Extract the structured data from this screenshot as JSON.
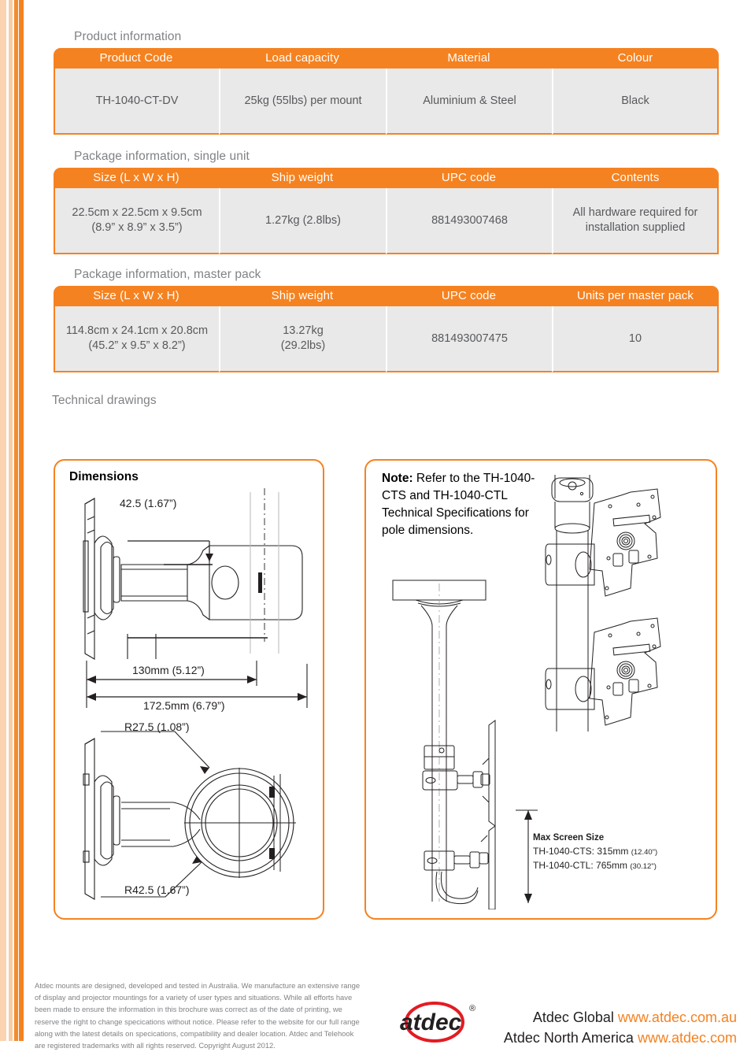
{
  "theme": {
    "accent": "#f58220",
    "header_text": "#ffffff",
    "cell_bg": "#e9e9ea",
    "label_gray": "#808285",
    "body_text": "#58595b"
  },
  "sections": {
    "product_information_label": "Product information",
    "package_single_label": "Package information, single unit",
    "package_master_label": "Package information, master pack",
    "technical_drawings_label": "Technical drawings"
  },
  "product_table": {
    "headers": [
      "Product Code",
      "Load capacity",
      "Material",
      "Colour"
    ],
    "rows": [
      [
        "TH-1040-CT-DV",
        "25kg (55lbs) per mount",
        "Aluminium & Steel",
        "Black"
      ]
    ]
  },
  "package_single_table": {
    "headers": [
      "Size (L x W x H)",
      "Ship weight",
      "UPC code",
      "Contents"
    ],
    "rows": [
      [
        "22.5cm x 22.5cm x 9.5cm\n(8.9” x 8.9” x 3.5”)",
        "1.27kg (2.8lbs)",
        "881493007468",
        "All hardware required for installation supplied"
      ]
    ]
  },
  "package_master_table": {
    "headers": [
      "Size (L x W x H)",
      "Ship weight",
      "UPC code",
      "Units per master pack"
    ],
    "rows": [
      [
        "114.8cm x 24.1cm x 20.8cm\n(45.2” x 9.5” x 8.2”)",
        "13.27kg\n(29.2lbs)",
        "881493007475",
        "10"
      ]
    ]
  },
  "dimensions_panel": {
    "title": "Dimensions",
    "labels": {
      "height_offset": "42.5 (1.67”)",
      "width_inner": "130mm (5.12”)",
      "width_outer": "172.5mm (6.79”)",
      "radius_inner": "R27.5 (1.08”)",
      "radius_outer": "R42.5 (1.67”)"
    }
  },
  "note_panel": {
    "note_prefix": "Note:",
    "note_body": " Refer to the TH-1040-CTS and TH-1040-CTL Technical Specifications for pole dimensions.",
    "max_screen": {
      "title": "Max Screen Size",
      "lines": [
        {
          "model": "TH-1040-CTS: 315mm",
          "inches": "(12.40\")"
        },
        {
          "model": "TH-1040-CTL: 765mm",
          "inches": "(30.12\")"
        }
      ]
    }
  },
  "footer": {
    "disclaimer": "Atdec mounts are designed, developed and tested in Australia. We manufacture an extensive range of display and projector mountings for a variety of user types and situations. While all efforts have been made to ensure the information in this brochure was correct as of the date of printing, we reserve the right to change specications without notice. Please refer to the website for our full range along with the latest details on specications, compatibility and dealer location. Atdec and Telehook are registered trademarks with all rights reserved. Copyright August 2012.",
    "logo_text": "atdec",
    "logo_trademark": "®",
    "contacts": [
      {
        "region": "Atdec Global",
        "url": "www.atdec.com.au"
      },
      {
        "region": "Atdec North America",
        "url": "www.atdec.com"
      }
    ]
  }
}
